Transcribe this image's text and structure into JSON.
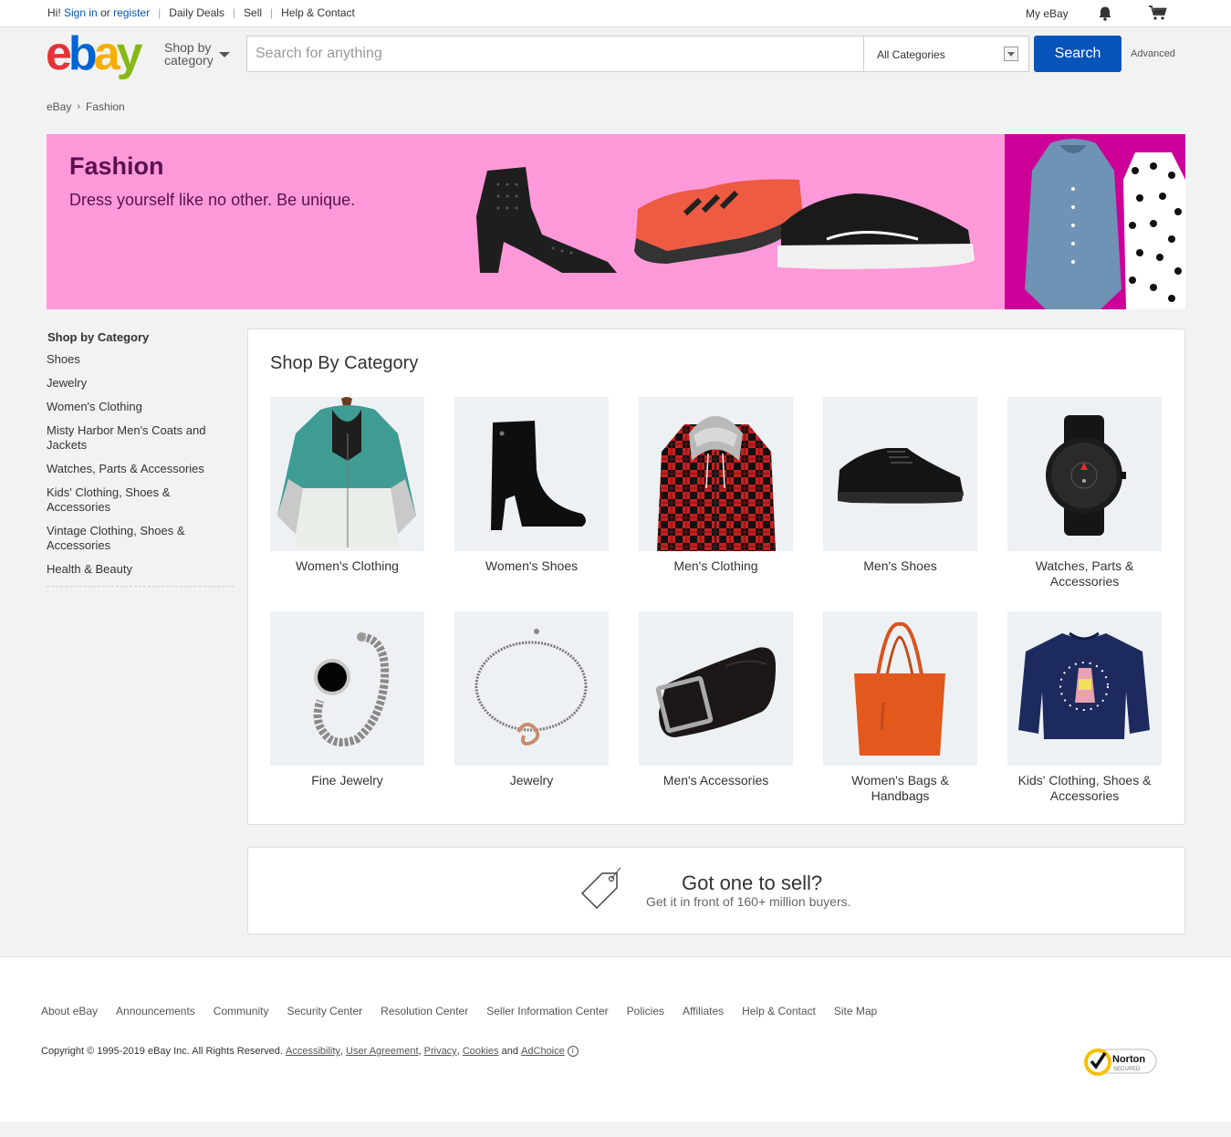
{
  "topbar": {
    "greeting": "Hi!",
    "sign_in": "Sign in",
    "or": "or",
    "register": "register",
    "links": [
      "Daily Deals",
      "Sell",
      "Help & Contact"
    ],
    "my_ebay": "My eBay"
  },
  "header": {
    "logo": {
      "e": "e",
      "b": "b",
      "a": "a",
      "y": "y"
    },
    "shop_by_1": "Shop by",
    "shop_by_2": "category",
    "search_placeholder": "Search for anything",
    "category_selected": "All Categories",
    "search_button": "Search",
    "advanced": "Advanced"
  },
  "breadcrumb": {
    "root": "eBay",
    "separator": "›",
    "current": "Fashion"
  },
  "banner": {
    "title": "Fashion",
    "subtitle": "Dress yourself like no other. Be unique."
  },
  "sidebar": {
    "title": "Shop by Category",
    "items": [
      "Shoes",
      "Jewelry",
      "Women's Clothing",
      "Misty Harbor Men's Coats and Jackets",
      "Watches, Parts & Accessories",
      "Kids' Clothing, Shoes & Accessories",
      "Vintage Clothing, Shoes & Accessories",
      "Health & Beauty"
    ]
  },
  "main": {
    "heading": "Shop By Category",
    "tiles": [
      {
        "label": "Women's Clothing",
        "icon": "jacket-icon"
      },
      {
        "label": "Women's Shoes",
        "icon": "boot-icon"
      },
      {
        "label": "Men's Clothing",
        "icon": "flannel-hoodie-icon"
      },
      {
        "label": "Men's Shoes",
        "icon": "sneaker-icon"
      },
      {
        "label": "Watches, Parts & Accessories",
        "icon": "watch-icon"
      },
      {
        "label": "Fine Jewelry",
        "icon": "ring-icon"
      },
      {
        "label": "Jewelry",
        "icon": "bracelet-icon"
      },
      {
        "label": "Men's Accessories",
        "icon": "belt-icon"
      },
      {
        "label": "Women's Bags & Handbags",
        "icon": "handbag-icon"
      },
      {
        "label": "Kids' Clothing, Shoes & Accessories",
        "icon": "sweatshirt-icon"
      }
    ]
  },
  "sell": {
    "heading": "Got one to sell?",
    "sub": "Get it in front of 160+ million buyers."
  },
  "footer": {
    "links": [
      "About eBay",
      "Announcements",
      "Community",
      "Security Center",
      "Resolution Center",
      "Seller Information Center",
      "Policies",
      "Affiliates",
      "Help & Contact",
      "Site Map"
    ],
    "copyright": "Copyright © 1995-2019 eBay Inc. All Rights Reserved.",
    "legal_links": [
      "Accessibility",
      "User Agreement",
      "Privacy",
      "Cookies"
    ],
    "and": "and",
    "adchoice": "AdChoice",
    "norton": "Norton",
    "norton_sub": "SECURED"
  },
  "colors": {
    "brand_blue": "#0654ba",
    "banner_pink": "#ff99d9",
    "banner_magenta": "#cc0099"
  }
}
